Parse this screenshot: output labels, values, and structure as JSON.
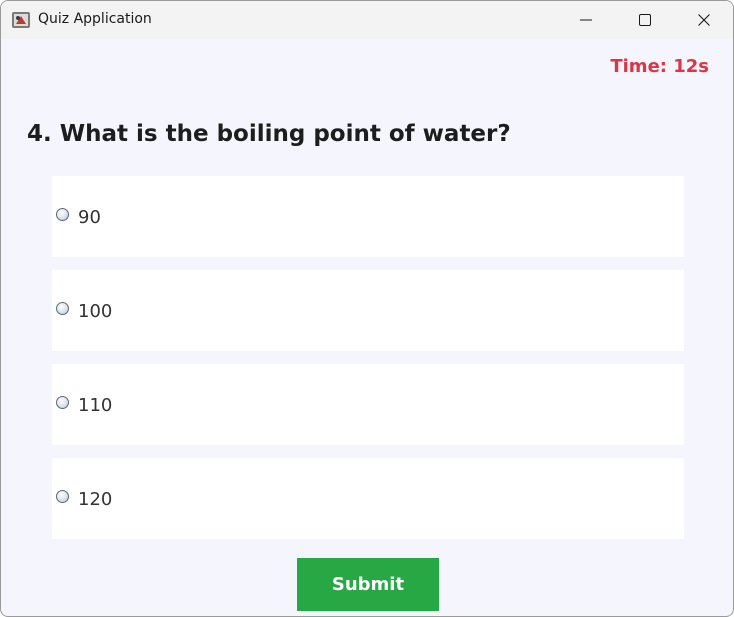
{
  "window": {
    "title": "Quiz Application",
    "icon": "java-app-icon",
    "controls": [
      "minimize-icon",
      "maximize-icon",
      "close-icon"
    ]
  },
  "timer": {
    "text": "Time: 12s",
    "color": "#dc3545"
  },
  "question": {
    "text": "4. What is the boiling point of water?"
  },
  "options": [
    {
      "label": "90",
      "selected": false
    },
    {
      "label": "100",
      "selected": false
    },
    {
      "label": "110",
      "selected": false
    },
    {
      "label": "120",
      "selected": false
    }
  ],
  "submit": {
    "label": "Submit",
    "color": "#28a745"
  },
  "colors": {
    "background": "#f5f5fd",
    "option_background": "#ffffff",
    "question_text": "#1d1d1d"
  }
}
